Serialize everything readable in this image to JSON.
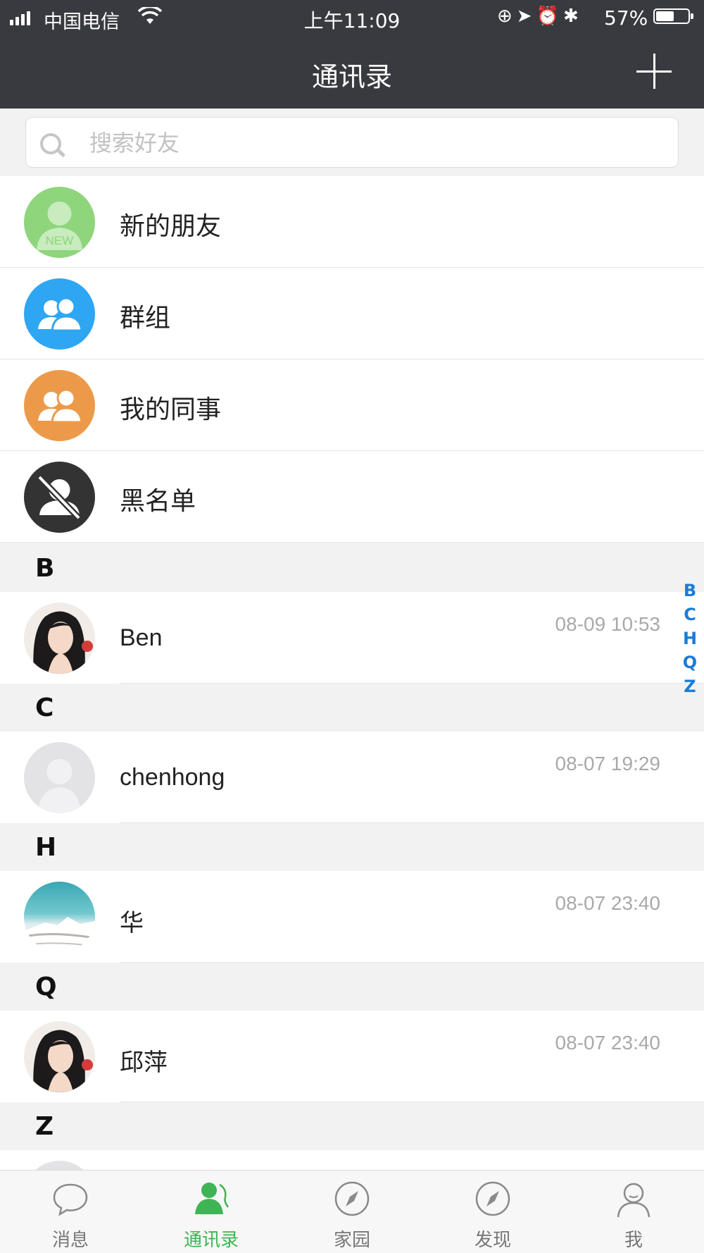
{
  "status_bar": {
    "carrier": "中国电信",
    "time": "上午11:09",
    "battery_percent": "57%",
    "battery_level": 0.57
  },
  "nav": {
    "title": "通讯录",
    "add_icon": "plus-icon"
  },
  "search": {
    "placeholder": "搜索好友",
    "icon": "search-icon"
  },
  "fixed_items": [
    {
      "label": "新的朋友",
      "icon": "new-friend-icon",
      "color": "#8ed57c",
      "badge": "NEW"
    },
    {
      "label": "群组",
      "icon": "group-icon",
      "color": "#2fa6f2"
    },
    {
      "label": "我的同事",
      "icon": "colleagues-icon",
      "color": "#ec9a4a"
    },
    {
      "label": "黑名单",
      "icon": "blocked-user-icon",
      "color": "#333333"
    }
  ],
  "sections": [
    {
      "letter": "B",
      "contacts": [
        {
          "name": "Ben",
          "time": "08-09 10:53",
          "avatar": "photo-woman"
        }
      ]
    },
    {
      "letter": "C",
      "contacts": [
        {
          "name": "chenhong",
          "time": "08-07 19:29",
          "avatar": "default-user"
        }
      ]
    },
    {
      "letter": "H",
      "contacts": [
        {
          "name": "华",
          "time": "08-07 23:40",
          "avatar": "photo-landscape"
        }
      ]
    },
    {
      "letter": "Q",
      "contacts": [
        {
          "name": "邱萍",
          "time": "08-07 23:40",
          "avatar": "photo-woman"
        }
      ]
    },
    {
      "letter": "Z",
      "contacts": []
    }
  ],
  "index_letters": [
    "B",
    "C",
    "H",
    "Q",
    "Z"
  ],
  "tabs": [
    {
      "label": "消息",
      "icon": "chat-bubble-icon",
      "active": false
    },
    {
      "label": "通讯录",
      "icon": "contacts-icon",
      "active": true
    },
    {
      "label": "家园",
      "icon": "compass-icon",
      "active": false
    },
    {
      "label": "发现",
      "icon": "compass-icon",
      "active": false
    },
    {
      "label": "我",
      "icon": "profile-icon",
      "active": false
    }
  ],
  "colors": {
    "header_bg": "#393a3f",
    "accent_green": "#3fb454",
    "index_blue": "#1a7cd8"
  }
}
